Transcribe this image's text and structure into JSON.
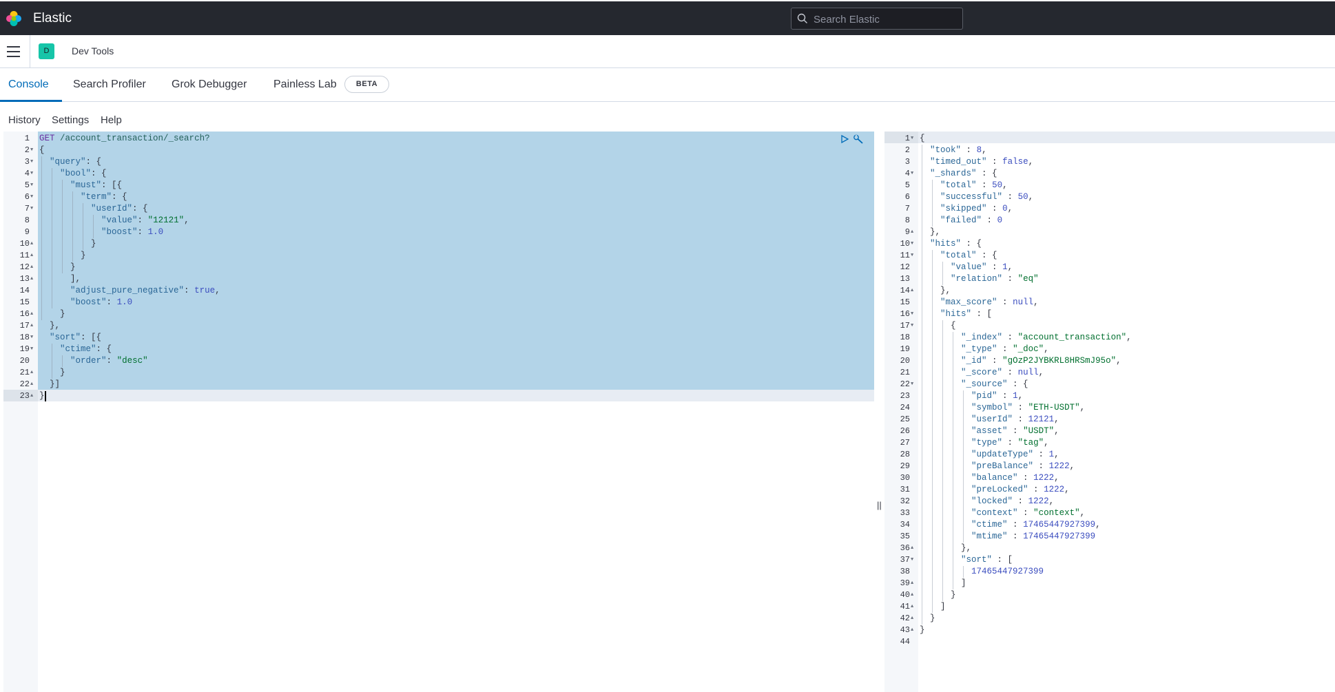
{
  "header": {
    "brand": "Elastic",
    "search_placeholder": "Search Elastic",
    "logo": "elastic-logo",
    "search_icon": "magnifier-icon"
  },
  "breadcrumb": {
    "avatar_letter": "D",
    "avatar_color": "#16c5a8",
    "title": "Dev Tools"
  },
  "tabs": [
    {
      "label": "Console",
      "active": true
    },
    {
      "label": "Search Profiler"
    },
    {
      "label": "Grok Debugger"
    },
    {
      "label": "Painless Lab"
    }
  ],
  "beta_badge": "BETA",
  "menu": [
    "History",
    "Settings",
    "Help"
  ],
  "request": {
    "lines": [
      "GET /account_transaction/_search?",
      "{",
      "  \"query\": {",
      "    \"bool\": {",
      "      \"must\": [{",
      "        \"term\": {",
      "          \"userId\": {",
      "            \"value\": \"12121\",",
      "            \"boost\": 1.0",
      "          }",
      "        }",
      "      }",
      "      ],",
      "      \"adjust_pure_negative\": true,",
      "      \"boost\": 1.0",
      "    }",
      "  },",
      "  \"sort\": [{",
      "    \"ctime\": {",
      "      \"order\": \"desc\"",
      "    }",
      "  }]",
      "}"
    ]
  },
  "response": {
    "lines": [
      "{",
      "  \"took\" : 8,",
      "  \"timed_out\" : false,",
      "  \"_shards\" : {",
      "    \"total\" : 50,",
      "    \"successful\" : 50,",
      "    \"skipped\" : 0,",
      "    \"failed\" : 0",
      "  },",
      "  \"hits\" : {",
      "    \"total\" : {",
      "      \"value\" : 1,",
      "      \"relation\" : \"eq\"",
      "    },",
      "    \"max_score\" : null,",
      "    \"hits\" : [",
      "      {",
      "        \"_index\" : \"account_transaction\",",
      "        \"_type\" : \"_doc\",",
      "        \"_id\" : \"gOzP2JYBKRL8HRSmJ95o\",",
      "        \"_score\" : null,",
      "        \"_source\" : {",
      "          \"pid\" : 1,",
      "          \"symbol\" : \"ETH-USDT\",",
      "          \"userId\" : 12121,",
      "          \"asset\" : \"USDT\",",
      "          \"type\" : \"tag\",",
      "          \"updateType\" : 1,",
      "          \"preBalance\" : 1222,",
      "          \"balance\" : 1222,",
      "          \"preLocked\" : 1222,",
      "          \"locked\" : 1222,",
      "          \"context\" : \"context\",",
      "          \"ctime\" : 17465447927399,",
      "          \"mtime\" : 17465447927399",
      "        },",
      "        \"sort\" : [",
      "          17465447927399",
      "        ]",
      "      }",
      "    ]",
      "  }",
      "}",
      ""
    ]
  },
  "resizer_glyph": "||",
  "icons": {
    "run": "play-icon",
    "wrench": "wrench-icon",
    "menu": "hamburger-icon"
  },
  "colors": {
    "header_bg": "#25282f",
    "accent": "#006bb8",
    "selection": "#b3d4e8"
  }
}
